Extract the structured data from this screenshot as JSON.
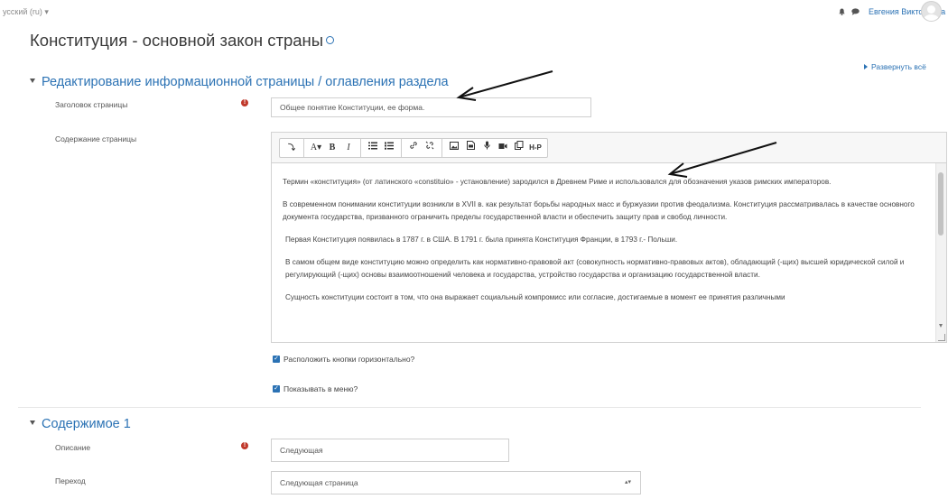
{
  "header": {
    "language": "усский (ru) ▾",
    "user_name": "Евгения Викторовна Кущенко",
    "icons": [
      "bell-icon",
      "chat-icon",
      "avatar"
    ]
  },
  "page": {
    "title": "Конституция - основной закон страны",
    "expand_all": "Развернуть всё"
  },
  "section1": {
    "title": "Редактирование информационной страницы / оглавления раздела",
    "page_title_label": "Заголовок страницы",
    "page_title_value": "Общее понятие Конституции, ее форма.",
    "content_label": "Содержание страницы",
    "toolbar": [
      "⤵",
      "A▾",
      "B",
      "I",
      "list-bullet-icon",
      "list-number-icon",
      "link-icon",
      "unlink-icon",
      "image-icon",
      "media-icon",
      "mic-icon",
      "video-icon",
      "copy-icon",
      "H-P"
    ],
    "content": [
      "Термин «конституция» (от латинского «constituio» - установление) зародился в Древнем Риме и использовался для обозначения указов римских императоров.",
      "В современном понимании конституции возникли в XVII в. как результат борьбы народных масс и буржуазии против феодализма. Конституция рассматривалась в качестве основного документа государства, призванного ограничить пределы государственной власти и обеспечить защиту прав и свобод личности.",
      "Первая Конституция появилась в 1787 г. в США. В 1791 г. была принята Конституция Франции, в 1793 г.- Польши.",
      "В самом общем виде конституцию можно определить как нормативно-правовой акт (совокупность нормативно-правовых актов), обладающий (-щих) высшей юридической силой и регулирующий (-щих) основы взаимоотношений человека и государства, устройство государства и организацию государственной власти.",
      "Сущность конституции состоит в том, что она выражает социальный компромисс или согласие, достигаемые в момент ее принятия различными"
    ],
    "checkbox_horizontal": "Расположить кнопки горизонтально?",
    "checkbox_menu": "Показывать в меню?"
  },
  "section2": {
    "title": "Содержимое 1",
    "description_label": "Описание",
    "description_value": "Следующая",
    "jump_label": "Переход",
    "jump_value": "Следующая страница"
  },
  "colors": {
    "accent": "#2b72b4",
    "required": "#c0392b"
  }
}
